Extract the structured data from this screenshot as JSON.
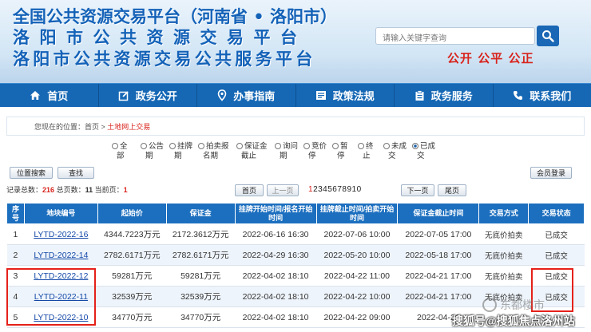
{
  "header": {
    "title_line1": "全国公共资源交易平台（河南省 • 洛阳市）",
    "title_line2": "洛阳市公共资源交易平台",
    "title_line3": "洛阳市公共资源交易公共服务平台",
    "search_placeholder": "请输入关键字查询",
    "slogan": "公开 公平 公正"
  },
  "nav": {
    "items": [
      {
        "label": "首页",
        "icon": "home-icon"
      },
      {
        "label": "政务公开",
        "icon": "edit-icon"
      },
      {
        "label": "办事指南",
        "icon": "location-icon"
      },
      {
        "label": "政策法规",
        "icon": "book-icon"
      },
      {
        "label": "政务服务",
        "icon": "clipboard-icon"
      },
      {
        "label": "联系我们",
        "icon": "phone-icon"
      }
    ]
  },
  "breadcrumb": {
    "prefix": "您现在的位置：",
    "home": "首页",
    "sep": " > ",
    "current": "土地网上交易"
  },
  "filters": [
    {
      "l1": "全",
      "l2": "部",
      "selected": false
    },
    {
      "l1": "公告",
      "l2": "期",
      "selected": false
    },
    {
      "l1": "挂牌",
      "l2": "期",
      "selected": false
    },
    {
      "l1": "拍卖报",
      "l2": "名期",
      "selected": false
    },
    {
      "l1": "保证金",
      "l2": "截止",
      "selected": false
    },
    {
      "l1": "询问",
      "l2": "期",
      "selected": false
    },
    {
      "l1": "竞价",
      "l2": "停",
      "selected": false
    },
    {
      "l1": "暂",
      "l2": "停",
      "selected": false
    },
    {
      "l1": "终",
      "l2": "止",
      "selected": false
    },
    {
      "l1": "未成",
      "l2": "交",
      "selected": false
    },
    {
      "l1": "已成",
      "l2": "交",
      "selected": true
    }
  ],
  "buttons": {
    "location_search": "位置搜索",
    "search": "查找",
    "member_login": "会员登录"
  },
  "pager": {
    "total_label": "记录总数：",
    "total": "216",
    "pages_label": "总页数：",
    "pages": "11",
    "current_label": "当前页：",
    "current": "1",
    "first": "首页",
    "prev": "上一页",
    "page_numbers_current": "1",
    "page_numbers_rest": "2345678910",
    "next": "下一页",
    "last": "尾页"
  },
  "table": {
    "headers": [
      "序号",
      "地块编号",
      "起始价",
      "保证金",
      "挂牌开始时间/报名开始时间",
      "挂牌截止时间/拍卖开始时间",
      "保证金截止时间",
      "交易方式",
      "交易状态"
    ],
    "rows": [
      [
        "1",
        "LYTD-2022-16",
        "4344.7223万元",
        "2172.3612万元",
        "2022-06-16 16:30",
        "2022-07-06 10:00",
        "2022-07-05 17:00",
        "无底价拍卖",
        "已成交"
      ],
      [
        "2",
        "LYTD-2022-14",
        "2782.6171万元",
        "2782.6171万元",
        "2022-04-29 16:30",
        "2022-05-20 10:00",
        "2022-05-18 17:00",
        "无底价拍卖",
        "已成交"
      ],
      [
        "3",
        "LYTD-2022-12",
        "59281万元",
        "59281万元",
        "2022-04-02 18:10",
        "2022-04-22 11:00",
        "2022-04-21 17:00",
        "无底价拍卖",
        "已成交"
      ],
      [
        "4",
        "LYTD-2022-11",
        "32539万元",
        "32539万元",
        "2022-04-02 18:10",
        "2022-04-22 10:00",
        "2022-04-21 17:00",
        "无底价拍卖",
        "已成交"
      ],
      [
        "5",
        "LYTD-2022-10",
        "34770万元",
        "34770万元",
        "2022-04-02 18:10",
        "2022-04-22 09:00",
        "2022-04-21",
        "",
        ""
      ]
    ]
  },
  "watermarks": {
    "wm1": "东都楼市",
    "wm2": "搜狐号@搜狐焦点洛州站"
  },
  "colors": {
    "brand_blue": "#1668b5",
    "accent_red": "#d8241d",
    "highlight_red": "#e5211a"
  }
}
